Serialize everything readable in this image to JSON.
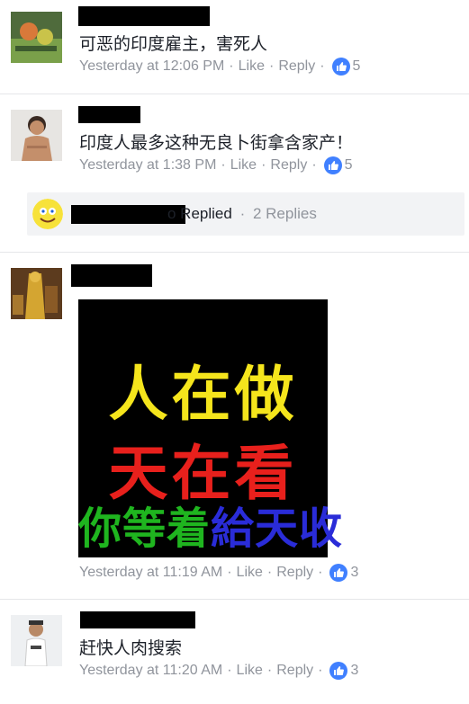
{
  "comments": [
    {
      "text": "可恶的印度雇主，害死人",
      "timestamp": "Yesterday at 12:06 PM",
      "like_label": "Like",
      "reply_label": "Reply",
      "like_count": "5"
    },
    {
      "text": "印度人最多这种无良卜街拿含家产！",
      "timestamp": "Yesterday at 1:38 PM",
      "like_label": "Like",
      "reply_label": "Reply",
      "like_count": "5"
    },
    {
      "text": "",
      "timestamp": "Yesterday at 11:19 AM",
      "like_label": "Like",
      "reply_label": "Reply",
      "like_count": "3"
    },
    {
      "text": "赶快人肉搜索",
      "timestamp": "Yesterday at 11:20 AM",
      "like_label": "Like",
      "reply_label": "Reply",
      "like_count": "3"
    }
  ],
  "reply_thread": {
    "label": "o Replied",
    "separator": "·",
    "count_label": "2 Replies"
  },
  "poster": {
    "line1": "人在做",
    "line2": "天在看",
    "line3_green": "你等着",
    "line3_blue": "給天收",
    "colors": {
      "line1": "#f5e51c",
      "line2": "#e8201c",
      "line3_green": "#1fb51f",
      "line3_blue": "#2a2cd8"
    }
  },
  "dot": "·",
  "icons": {
    "like": "thumbs-up-icon"
  }
}
